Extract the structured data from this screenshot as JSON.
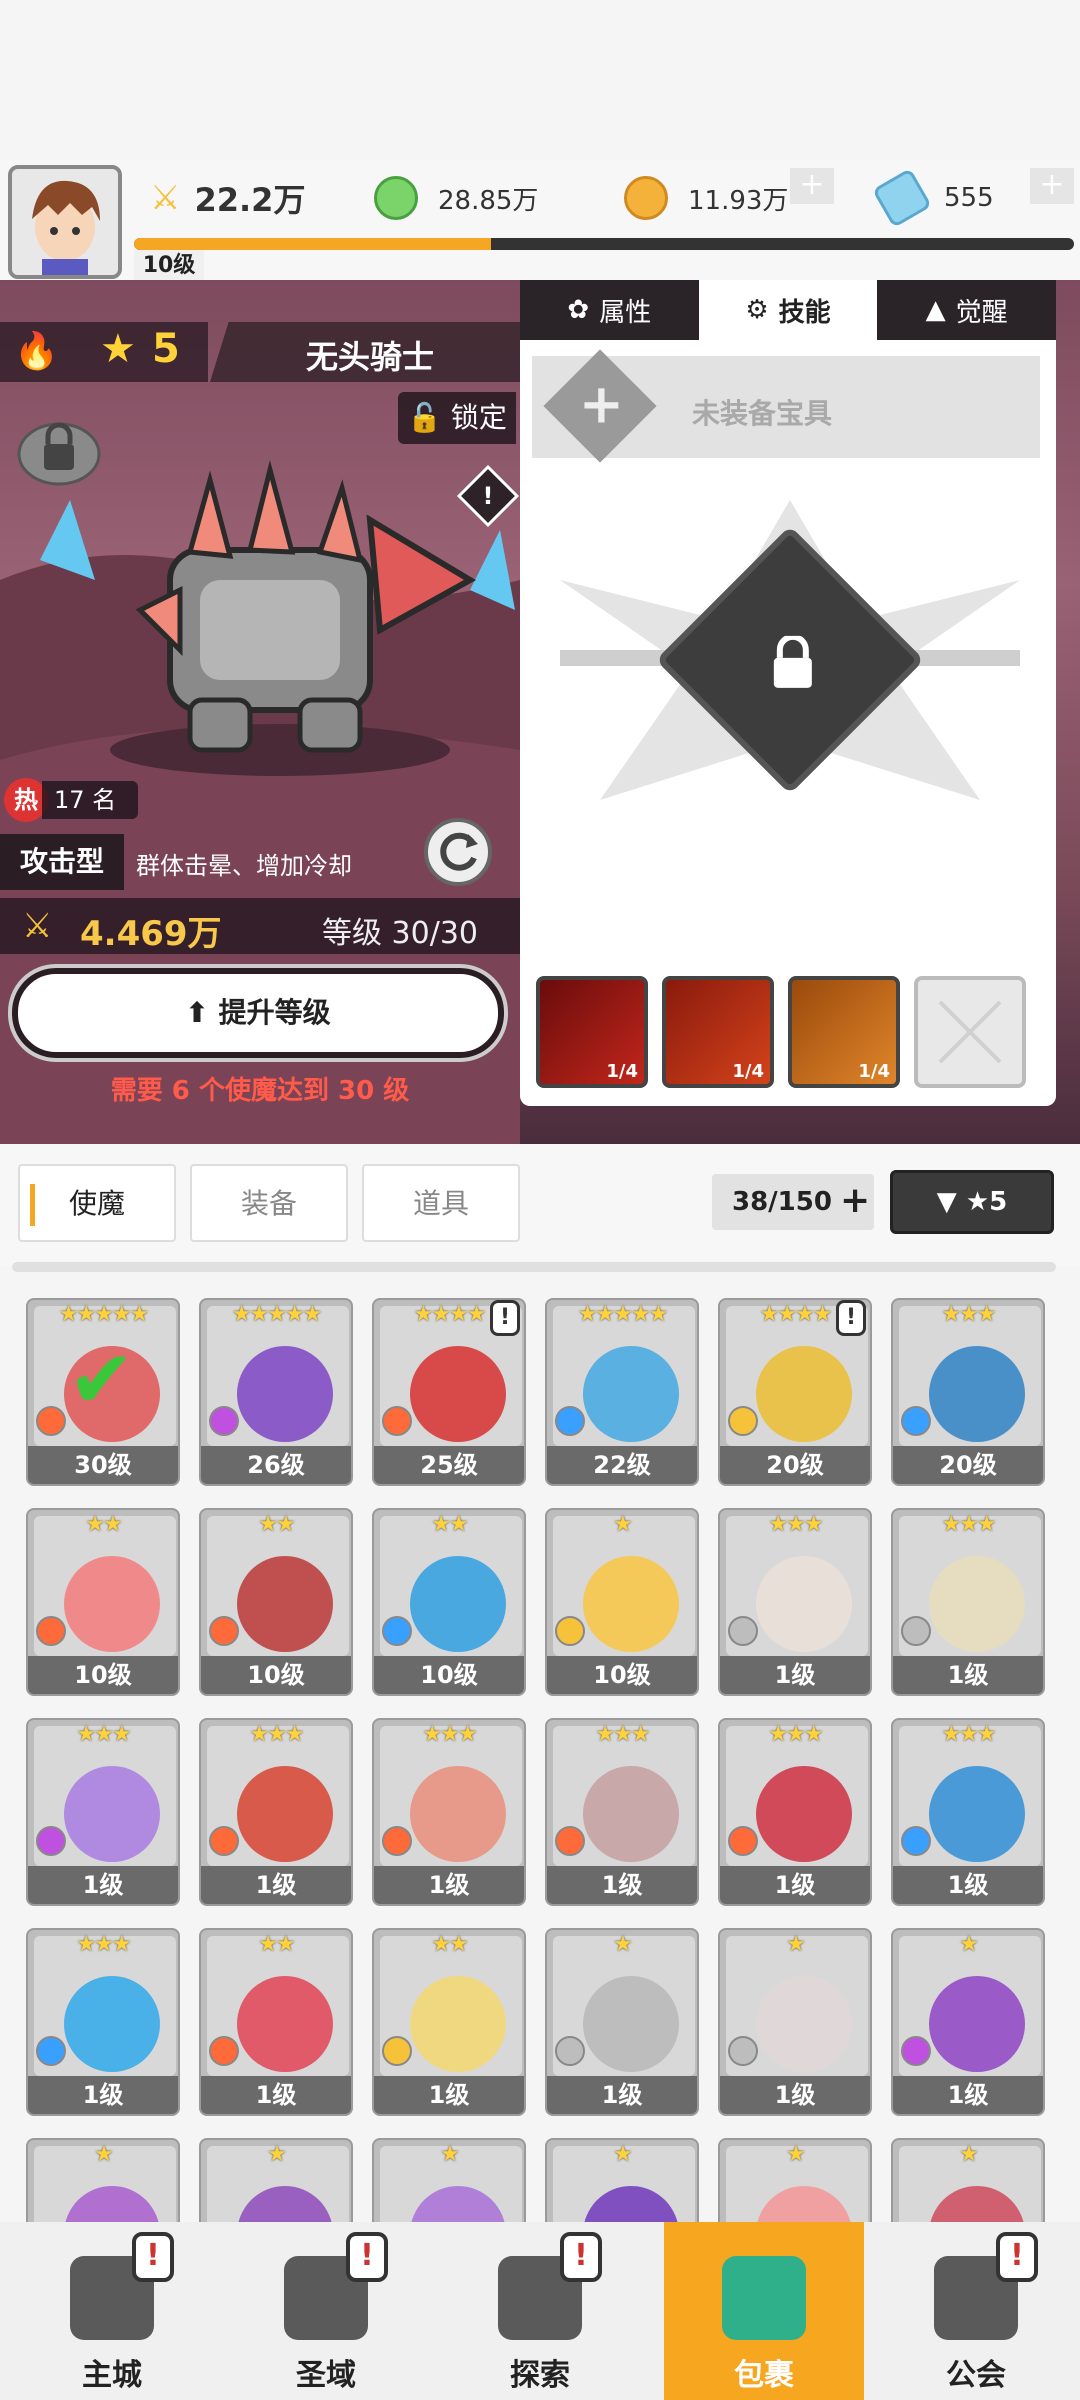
{
  "player": {
    "level_label": "10级",
    "power": "22.2万",
    "xp_fraction": 0.38
  },
  "resources": [
    {
      "name": "green-gem",
      "value": "28.85万",
      "color": "#7bd46a"
    },
    {
      "name": "gold-coin",
      "value": "11.93万",
      "color": "#f5b23a"
    },
    {
      "name": "blue-crystal",
      "value": "555",
      "color": "#8fd3ef"
    }
  ],
  "hero": {
    "stars": "5",
    "name": "无头骑士",
    "lock_label": "锁定",
    "warn": "!",
    "hot_label": "热",
    "rank": "17 名",
    "type": "攻击型",
    "desc": "群体击晕、增加冷却",
    "power": "4.469万",
    "level": "等级 30/30",
    "upgrade_label": "提升等级",
    "need_text": "需要 6 个使魔达到 30 级"
  },
  "skill_panel": {
    "tabs": [
      "属性",
      "技能",
      "觉醒"
    ],
    "active_tab": 1,
    "equip_label": "未装备宝具",
    "skill_icons": [
      {
        "count": "1/4",
        "color": "#c2261b"
      },
      {
        "count": "1/4",
        "color": "#d4431b"
      },
      {
        "count": "1/4",
        "color": "#e0852a"
      }
    ]
  },
  "bag": {
    "tabs": [
      "使魔",
      "装备",
      "道具"
    ],
    "active_tab": 0,
    "capacity": "38/150",
    "filter_label": "▼ ★5"
  },
  "cards": [
    {
      "stars": "★★★★★",
      "level": "30级",
      "color": "#e06a6a",
      "elem": "fire",
      "alert": false,
      "check": true
    },
    {
      "stars": "★★★★★",
      "level": "26级",
      "color": "#8b5cc8",
      "elem": "dark",
      "alert": false,
      "check": false
    },
    {
      "stars": "★★★★",
      "level": "25级",
      "color": "#d84a4a",
      "elem": "fire",
      "alert": true,
      "check": false
    },
    {
      "stars": "★★★★★",
      "level": "22级",
      "color": "#5ab0e0",
      "elem": "water",
      "alert": false,
      "check": false
    },
    {
      "stars": "★★★★",
      "level": "20级",
      "color": "#e8c24a",
      "elem": "light",
      "alert": true,
      "check": false
    },
    {
      "stars": "★★★",
      "level": "20级",
      "color": "#4a90c8",
      "elem": "water",
      "alert": false,
      "check": false
    },
    {
      "stars": "★★",
      "level": "10级",
      "color": "#f08a8a",
      "elem": "fire",
      "alert": false,
      "check": false
    },
    {
      "stars": "★★",
      "level": "10级",
      "color": "#c05050",
      "elem": "fire",
      "alert": false,
      "check": false
    },
    {
      "stars": "★★",
      "level": "10级",
      "color": "#4aa8e0",
      "elem": "water",
      "alert": false,
      "check": false
    },
    {
      "stars": "★",
      "level": "10级",
      "color": "#f5c85a",
      "elem": "light",
      "alert": false,
      "check": false
    },
    {
      "stars": "★★★",
      "level": "1级",
      "color": "#e8e0d8",
      "elem": "metal",
      "alert": false,
      "check": false
    },
    {
      "stars": "★★★",
      "level": "1级",
      "color": "#e6dcc0",
      "elem": "metal",
      "alert": false,
      "check": false
    },
    {
      "stars": "★★★",
      "level": "1级",
      "color": "#b08ae0",
      "elem": "dark",
      "alert": false,
      "check": false
    },
    {
      "stars": "★★★",
      "level": "1级",
      "color": "#d85a4a",
      "elem": "fire",
      "alert": false,
      "check": false
    },
    {
      "stars": "★★★",
      "level": "1级",
      "color": "#e89a8a",
      "elem": "fire",
      "alert": false,
      "check": false
    },
    {
      "stars": "★★★",
      "level": "1级",
      "color": "#c8a8a8",
      "elem": "fire",
      "alert": false,
      "check": false
    },
    {
      "stars": "★★★",
      "level": "1级",
      "color": "#d04a5a",
      "elem": "fire",
      "alert": false,
      "check": false
    },
    {
      "stars": "★★★",
      "level": "1级",
      "color": "#4a9ad8",
      "elem": "water",
      "alert": false,
      "check": false
    },
    {
      "stars": "★★★",
      "level": "1级",
      "color": "#4ab0e8",
      "elem": "water",
      "alert": false,
      "check": false
    },
    {
      "stars": "★★",
      "level": "1级",
      "color": "#e05a6a",
      "elem": "fire",
      "alert": false,
      "check": false
    },
    {
      "stars": "★★",
      "level": "1级",
      "color": "#f0d880",
      "elem": "light",
      "alert": false,
      "check": false
    },
    {
      "stars": "★",
      "level": "1级",
      "color": "#bdbdbd",
      "elem": "metal",
      "alert": false,
      "check": false
    },
    {
      "stars": "★",
      "level": "1级",
      "color": "#e0d8d8",
      "elem": "metal",
      "alert": false,
      "check": false
    },
    {
      "stars": "★",
      "level": "1级",
      "color": "#9a5ac8",
      "elem": "dark",
      "alert": false,
      "check": false
    },
    {
      "stars": "★",
      "level": "",
      "color": "#b070d0",
      "elem": "",
      "alert": false,
      "check": false
    },
    {
      "stars": "★",
      "level": "",
      "color": "#9a60c0",
      "elem": "",
      "alert": false,
      "check": false
    },
    {
      "stars": "★",
      "level": "",
      "color": "#b080d8",
      "elem": "",
      "alert": false,
      "check": false
    },
    {
      "stars": "★",
      "level": "",
      "color": "#8050c0",
      "elem": "",
      "alert": false,
      "check": false
    },
    {
      "stars": "★",
      "level": "",
      "color": "#f0a0a0",
      "elem": "",
      "alert": false,
      "check": false
    },
    {
      "stars": "★",
      "level": "",
      "color": "#d06070",
      "elem": "",
      "alert": false,
      "check": false
    }
  ],
  "nav": [
    {
      "label": "主城",
      "icon": "castle-icon",
      "alert": "!",
      "active": false
    },
    {
      "label": "圣域",
      "icon": "vortex-icon",
      "alert": "!",
      "active": false
    },
    {
      "label": "探索",
      "icon": "sword-icon",
      "alert": "!",
      "active": false
    },
    {
      "label": "包裹",
      "icon": "bag-icon",
      "alert": "",
      "active": true
    },
    {
      "label": "公会",
      "icon": "guild-icon",
      "alert": "!",
      "active": false
    }
  ]
}
